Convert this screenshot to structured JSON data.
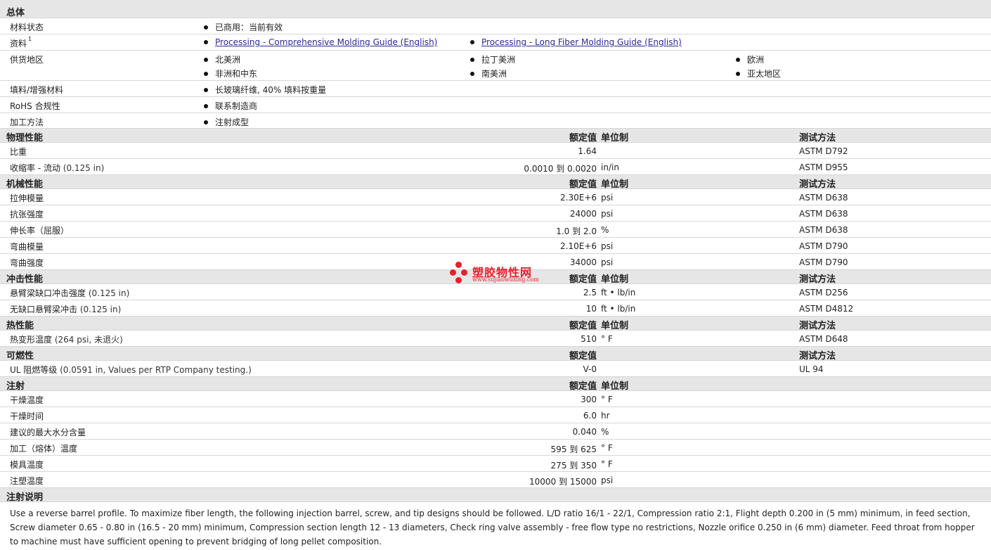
{
  "sections": {
    "general": "总体",
    "physical": "物理性能",
    "mechanical": "机械性能",
    "impact": "冲击性能",
    "thermal": "热性能",
    "flammability": "可燃性",
    "injection": "注射",
    "injection_notes": "注射说明"
  },
  "columns": {
    "nominal": "额定值",
    "unit": "单位制",
    "method": "测试方法"
  },
  "general": {
    "material_status": {
      "label": "材料状态",
      "value": "已商用：当前有效"
    },
    "documents": {
      "label": "资料",
      "sup": "1",
      "links": [
        "Processing - Comprehensive Molding Guide (English)",
        "Processing - Long Fiber Molding Guide (English)"
      ]
    },
    "availability": {
      "label": "供货地区",
      "items": [
        "北美洲",
        "拉丁美洲",
        "欧洲",
        "非洲和中东",
        "南美洲",
        "亚太地区"
      ]
    },
    "filler": {
      "label": "填料/增强材料",
      "value": "长玻璃纤维, 40% 填料按重量"
    },
    "rohs": {
      "label": "RoHS 合规性",
      "value": "联系制造商"
    },
    "processing": {
      "label": "加工方法",
      "value": "注射成型"
    }
  },
  "physical": [
    {
      "label": "比重",
      "cond": "",
      "value": "1.64",
      "unit": "",
      "method": "ASTM D792"
    },
    {
      "label": "收缩率 - 流动",
      "cond": "(0.125 in)",
      "value": "0.0010 到  0.0020",
      "unit": "in/in",
      "method": "ASTM D955"
    }
  ],
  "mechanical": [
    {
      "label": "拉伸模量",
      "cond": "",
      "value": "2.30E+6",
      "unit": "psi",
      "method": "ASTM D638"
    },
    {
      "label": "抗张强度",
      "cond": "",
      "value": "24000",
      "unit": "psi",
      "method": "ASTM D638"
    },
    {
      "label": "伸长率（屈服）",
      "cond": "",
      "value": "1.0 到  2.0",
      "unit": "%",
      "method": "ASTM D638"
    },
    {
      "label": "弯曲模量",
      "cond": "",
      "value": "2.10E+6",
      "unit": "psi",
      "method": "ASTM D790"
    },
    {
      "label": "弯曲强度",
      "cond": "",
      "value": "34000",
      "unit": "psi",
      "method": "ASTM D790"
    }
  ],
  "impact": [
    {
      "label": "悬臂梁缺口冲击强度",
      "cond": "(0.125 in)",
      "value": "2.5",
      "unit": "ft • lb/in",
      "method": "ASTM D256"
    },
    {
      "label": "无缺口悬臂梁冲击",
      "cond": "(0.125 in)",
      "value": "10",
      "unit": "ft • lb/in",
      "method": "ASTM D4812"
    }
  ],
  "thermal": [
    {
      "label": "热变形温度",
      "cond": "(264 psi, 未退火)",
      "value": "510",
      "unit": "° F",
      "method": "ASTM D648"
    }
  ],
  "flammability": [
    {
      "label": "UL 阻燃等级",
      "cond": "(0.0591 in, Values per RTP Company testing.)",
      "value": "V-0",
      "unit": "",
      "method": "UL 94"
    }
  ],
  "injection": [
    {
      "label": "干燥温度",
      "cond": "",
      "value": "300",
      "unit": "° F",
      "method": ""
    },
    {
      "label": "干燥时间",
      "cond": "",
      "value": "6.0",
      "unit": "hr",
      "method": ""
    },
    {
      "label": "建议的最大水分含量",
      "cond": "",
      "value": "0.040",
      "unit": "%",
      "method": ""
    },
    {
      "label": "加工（熔体）温度",
      "cond": "",
      "value": "595 到  625",
      "unit": "° F",
      "method": ""
    },
    {
      "label": "模具温度",
      "cond": "",
      "value": "275 到  350",
      "unit": "° F",
      "method": ""
    },
    {
      "label": "注塑温度",
      "cond": "",
      "value": "10000 到  15000",
      "unit": "psi",
      "method": ""
    }
  ],
  "notes_text": "Use a reverse barrel profile. To maximize fiber length, the following injection barrel, screw, and tip designs should be followed. L/D ratio 16/1 - 22/1, Compression ratio 2:1, Flight depth 0.200 in (5 mm) minimum, in feed section, Screw diameter 0.65 - 0.80 in (16.5 - 20 mm) minimum, Compression section length 12 - 13 diameters, Check ring valve assembly - free flow type no restrictions, Nozzle orifice 0.250 in (6 mm) diameter. Feed throat from hopper to machine must have sufficient opening to prevent bridging of long pellet composition.",
  "watermark": {
    "name": "塑胶物性网",
    "url": "www.sujiaowuxing.com",
    "color": "#e8202a"
  }
}
